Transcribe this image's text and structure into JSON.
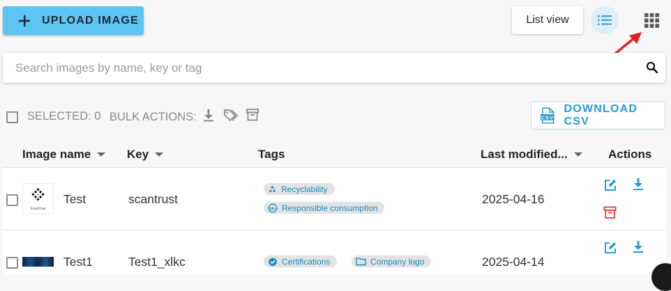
{
  "toolbar": {
    "upload_label": "UPLOAD IMAGE",
    "list_view_label": "List view"
  },
  "search": {
    "placeholder": "Search images by name, key or tag"
  },
  "bulk": {
    "selected_label": "SELECTED: 0",
    "bulk_actions_label": "BULK ACTIONS:",
    "download_csv_label": "DOWNLOAD CSV"
  },
  "table": {
    "columns": {
      "name": "Image name",
      "key": "Key",
      "tags": "Tags",
      "modified": "Last modified...",
      "actions": "Actions"
    },
    "rows": [
      {
        "name": "Test",
        "key": "scantrust",
        "thumb_text": "ScanTrust",
        "tags": [
          {
            "label": "Recyclability",
            "icon": "recycle-icon"
          },
          {
            "label": "Responsible consumption",
            "icon": "18-plus-icon"
          }
        ],
        "modified": "2025-04-16"
      },
      {
        "name": "Test1",
        "key": "Test1_xlkc",
        "tags": [
          {
            "label": "Certifications",
            "icon": "verified-icon"
          },
          {
            "label": "Company logo",
            "icon": "folder-icon"
          }
        ],
        "modified": "2025-04-14"
      }
    ]
  },
  "colors": {
    "accent": "#5ec4f2",
    "link_blue": "#2a9ad6",
    "danger": "#e0423c",
    "annotation_arrow": "#e02020"
  }
}
